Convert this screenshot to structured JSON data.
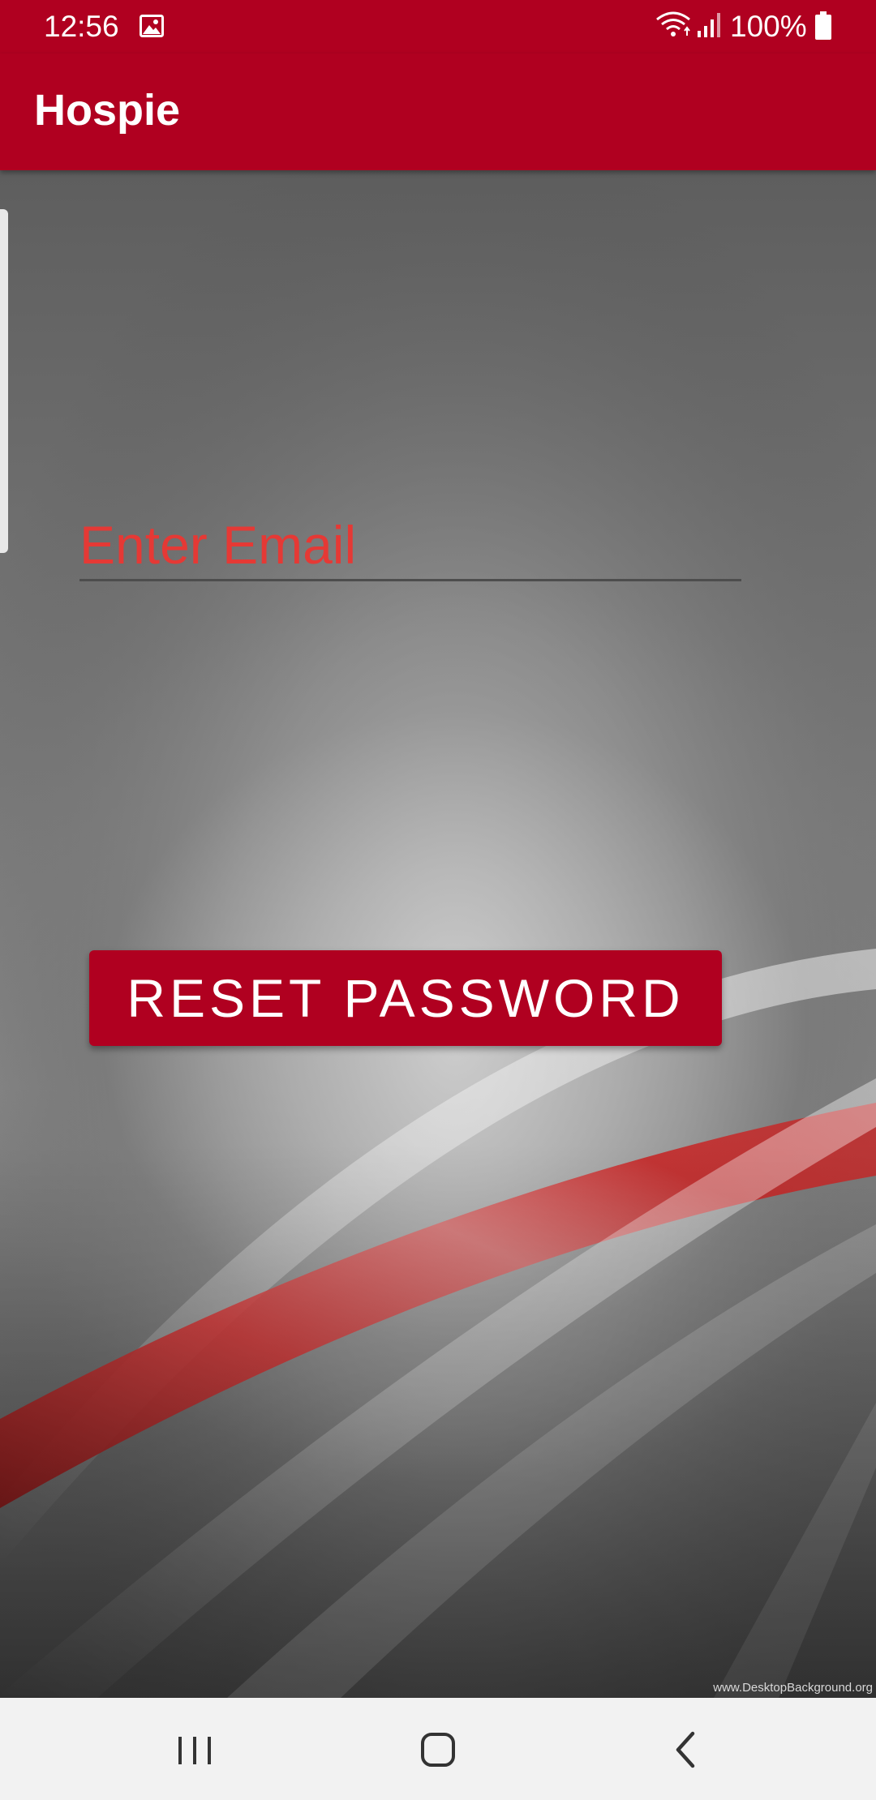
{
  "status_bar": {
    "time": "12:56",
    "battery": "100%",
    "icons": [
      "gallery-icon",
      "wifi-icon",
      "signal-icon",
      "battery-icon"
    ]
  },
  "app_bar": {
    "title": "Hospie"
  },
  "form": {
    "email_placeholder": "Enter Email",
    "email_value": "",
    "reset_button_label": "RESET PASSWORD"
  },
  "watermark": "www.DesktopBackground.org",
  "nav_bar": {
    "icons": [
      "recents-icon",
      "home-icon",
      "back-icon"
    ]
  },
  "colors": {
    "brand": "#b00020",
    "placeholder": "#e53935",
    "nav_background": "#f2f2f2"
  }
}
